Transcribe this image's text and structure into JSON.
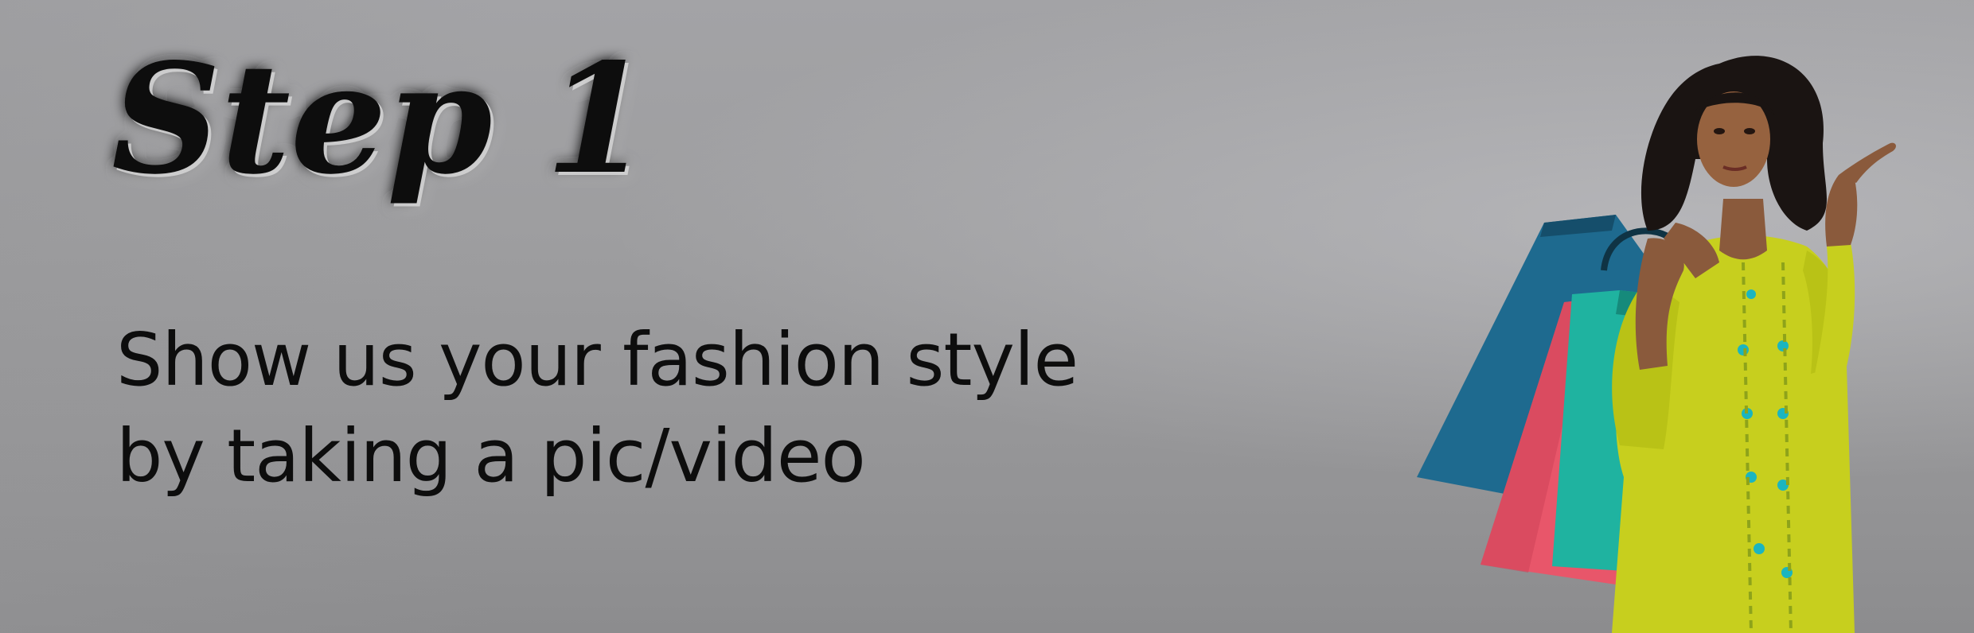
{
  "step": {
    "label": "Step 1"
  },
  "tagline": {
    "line1": "Show us your fashion style",
    "line2": "by taking a pic/video"
  },
  "colors": {
    "background": "#9d9d9f",
    "text": "#0d0d0d",
    "kurta": "#c7cf1e",
    "bag_blue": "#1e6a8f",
    "bag_pink": "#e8566a",
    "bag_teal": "#1fb3a0"
  },
  "photo": {
    "subject": "woman-holding-shopping-bags-pointing"
  }
}
